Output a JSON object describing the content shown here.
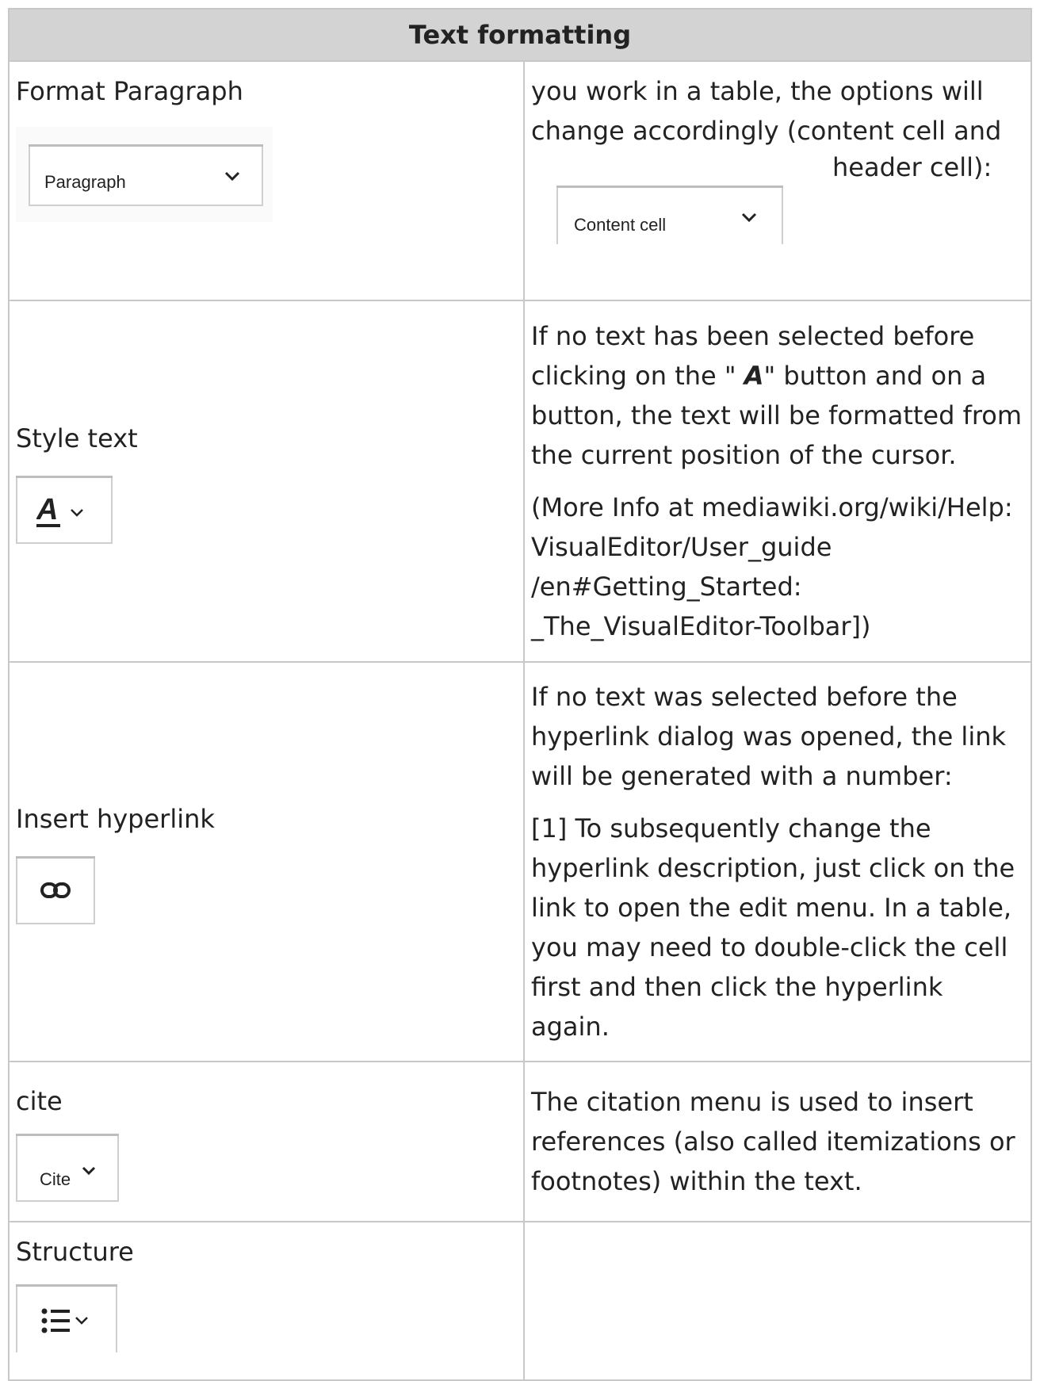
{
  "table": {
    "header": "Text formatting",
    "rows": [
      {
        "label": "Format Paragraph",
        "widget_text": "Paragraph",
        "desc_lines": [
          "you work in a table, the options will change accordingly (content cell and",
          "header cell):"
        ],
        "desc_widget_text": "Content cell"
      },
      {
        "label": "Style text",
        "widget_icon": "A",
        "desc_before": "If no text has been selected before clicking on the \" ",
        "desc_icon": "A",
        "desc_after": "\" button and on a button, the text will be formatted from the current position of the cursor.",
        "desc2": "(More Info at mediawiki.org/wiki/Help: VisualEditor/User_guide /en#Getting_Started: _The_VisualEditor-Toolbar])"
      },
      {
        "label": "Insert hyperlink",
        "desc1": "If no text was selected before the hyperlink dialog was opened, the link will be generated with a number:",
        "desc2": "[1] To subsequently change the hyperlink description, just click on the link to open the edit menu. In a table, you may need to double-click the cell first and then click the hyperlink again."
      },
      {
        "label": "cite",
        "widget_text": "Cite",
        "desc": "The citation menu is used to insert references (also called itemizations or footnotes) within the text."
      },
      {
        "label": "Structure",
        "desc": ""
      }
    ]
  }
}
